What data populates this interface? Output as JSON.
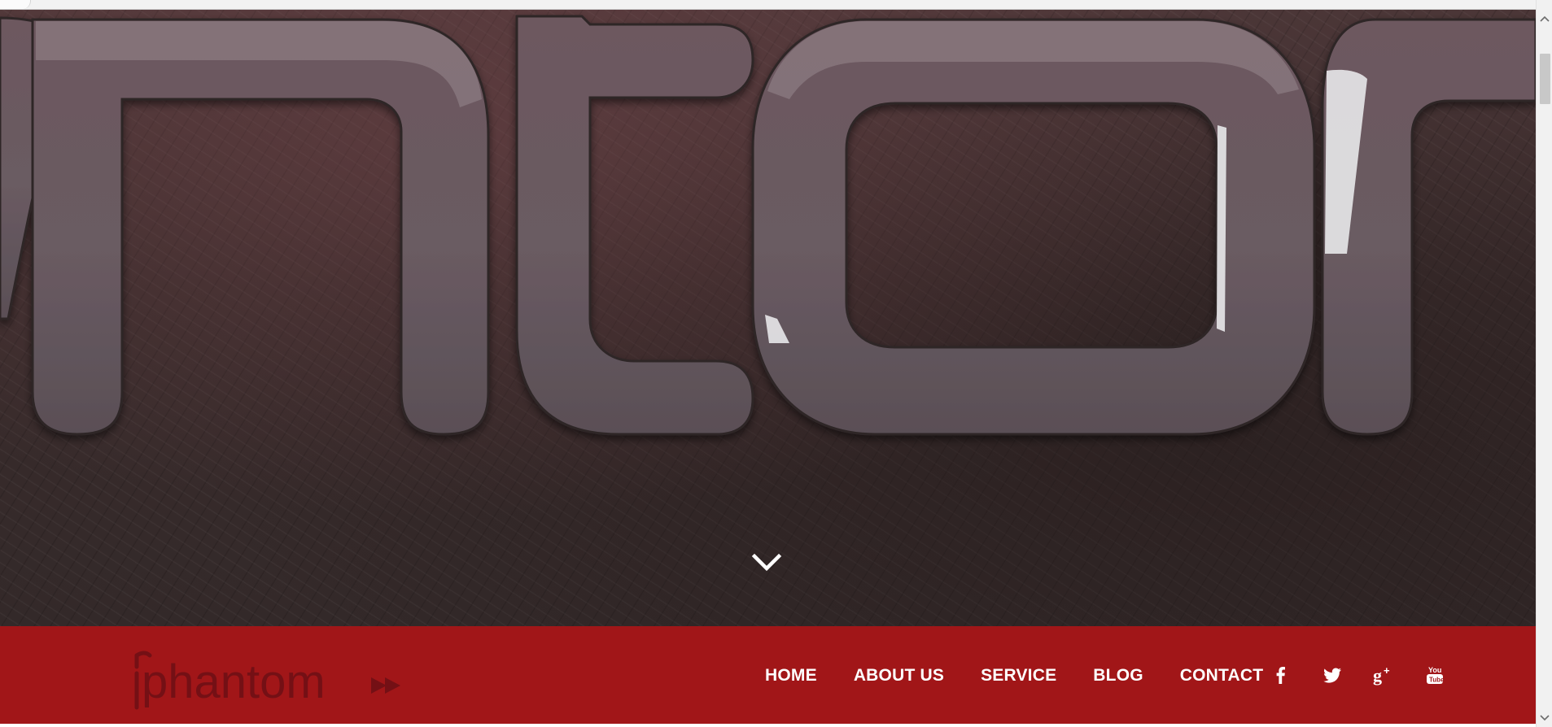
{
  "hero": {
    "background_text": "ntom",
    "scroll_icon": "chevron-down-icon"
  },
  "navbar": {
    "brand_text": "phantom",
    "background_color": "#a11618",
    "brand_color": "#7a0f12",
    "items": [
      {
        "label": "HOME"
      },
      {
        "label": "ABOUT US"
      },
      {
        "label": "SERVICE"
      },
      {
        "label": "BLOG"
      },
      {
        "label": "CONTACT"
      }
    ],
    "social": [
      {
        "icon": "facebook-icon"
      },
      {
        "icon": "twitter-icon"
      },
      {
        "icon": "google-plus-icon"
      },
      {
        "icon": "youtube-icon"
      }
    ]
  },
  "scrollbar": {
    "up_icon": "scroll-up-arrow-icon",
    "down_icon": "scroll-down-arrow-icon"
  }
}
